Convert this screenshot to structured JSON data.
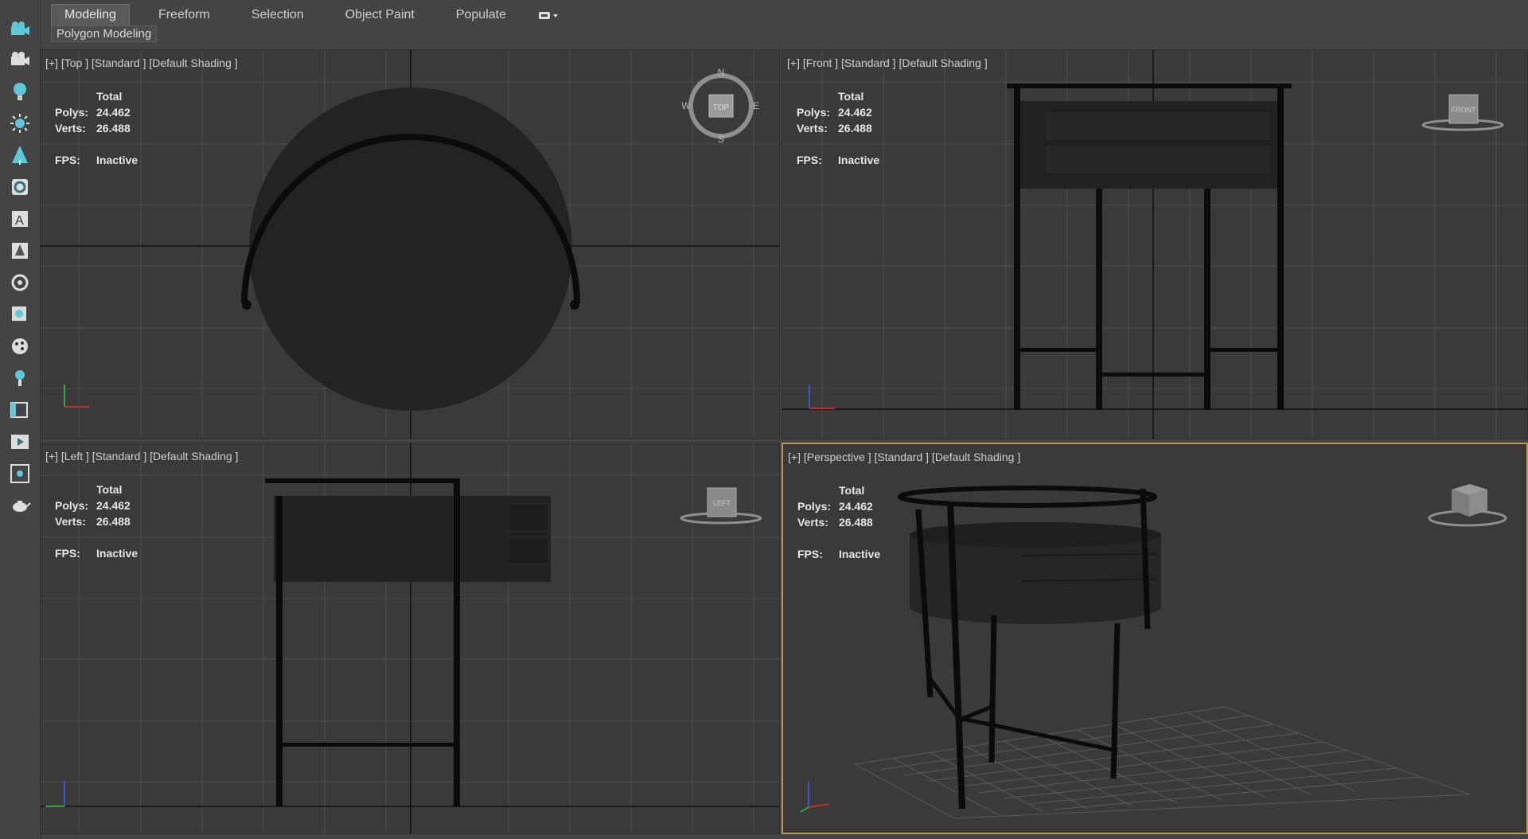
{
  "ribbon": {
    "tabs": [
      {
        "label": "Modeling",
        "active": true
      },
      {
        "label": "Freeform",
        "active": false
      },
      {
        "label": "Selection",
        "active": false
      },
      {
        "label": "Object Paint",
        "active": false
      },
      {
        "label": "Populate",
        "active": false
      }
    ],
    "panel_label": "Polygon Modeling"
  },
  "left_toolbar": {
    "icons": [
      "camera-icon",
      "camera-settings-icon",
      "light-bulb-icon",
      "sun-icon",
      "foliage-icon",
      "rotate-view-icon",
      "text-panel-icon",
      "tree-icon",
      "orbit-icon",
      "render-frame-icon",
      "material-icon",
      "light-icon",
      "viewport-icon",
      "render-icon",
      "scene-icon",
      "teapot-icon"
    ]
  },
  "viewports": {
    "top": {
      "label": "[+] [Top ] [Standard ] [Default Shading ]",
      "compass": {
        "n": "N",
        "s": "S",
        "e": "E",
        "w": "W",
        "cube": "TOP"
      }
    },
    "front": {
      "label": "[+] [Front ] [Standard ] [Default Shading ]",
      "cube": "FRONT"
    },
    "left": {
      "label": "[+] [Left ] [Standard ] [Default Shading ]",
      "cube": "LEFT"
    },
    "perspective": {
      "label": "[+] [Perspective ] [Standard ] [Default Shading ]",
      "active": true
    }
  },
  "stats": {
    "total_label": "Total",
    "polys_label": "Polys:",
    "polys_value": "24.462",
    "verts_label": "Verts:",
    "verts_value": "26.488",
    "fps_label": "FPS:",
    "fps_value": "Inactive"
  },
  "colors": {
    "accent_active_viewport": "#b59a5a",
    "toolbar_icon": "#5fc8d8"
  }
}
